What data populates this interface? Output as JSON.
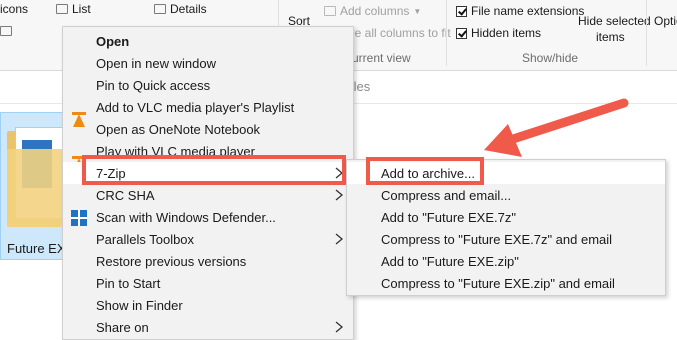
{
  "ribbon": {
    "layout_items": [
      {
        "label": "icons",
        "icon": "large-icons-icon"
      },
      {
        "label": "List",
        "icon": "list-icon"
      },
      {
        "label": "Details",
        "icon": "details-icon"
      }
    ],
    "sort_label": "Sort",
    "add_columns_label": "Add columns",
    "size_columns_label": "ize all columns to fit",
    "current_view_label": "urrent view",
    "file_name_extensions_label": "File name extensions",
    "hidden_items_label": "Hidden items",
    "hide_selected_line1": "Hide selected",
    "hide_selected_line2": "items",
    "show_hide_label": "Show/hide",
    "options_label": "Optic"
  },
  "address_bar": {
    "search_text": "n Files"
  },
  "file": {
    "label": "Future EXE"
  },
  "context_menu": {
    "items": [
      {
        "label": "Open",
        "bold": true,
        "icon": ""
      },
      {
        "label": "Open in new window",
        "icon": ""
      },
      {
        "label": "Pin to Quick access",
        "icon": ""
      },
      {
        "label": "Add to VLC media player's Playlist",
        "icon": "vlc-icon"
      },
      {
        "label": "Open as OneNote Notebook",
        "icon": ""
      },
      {
        "label": "Play with VLC media player",
        "icon": "vlc-icon"
      },
      {
        "label": "7-Zip",
        "icon": "",
        "submenu": true,
        "highlighted": true
      },
      {
        "label": "CRC SHA",
        "icon": "",
        "submenu": true
      },
      {
        "label": "Scan with Windows Defender...",
        "icon": "windows-defender-icon"
      },
      {
        "label": "Parallels Toolbox",
        "icon": "",
        "submenu": true
      },
      {
        "label": "Restore previous versions",
        "icon": ""
      },
      {
        "label": "Pin to Start",
        "icon": ""
      },
      {
        "label": "Show in Finder",
        "icon": ""
      },
      {
        "label": "Share on",
        "icon": "",
        "submenu": true
      }
    ]
  },
  "submenu": {
    "items": [
      {
        "label": "Add to archive...",
        "highlighted": true
      },
      {
        "label": "Compress and email..."
      },
      {
        "label": "Add to \"Future EXE.7z\""
      },
      {
        "label": "Compress to \"Future EXE.7z\" and email"
      },
      {
        "label": "Add to \"Future EXE.zip\""
      },
      {
        "label": "Compress to \"Future EXE.zip\" and email"
      }
    ]
  },
  "colors": {
    "highlight_box": "#ef5a4a",
    "arrow": "#ef5a4a",
    "menu_background": "#f2f2f2",
    "selected_tile": "#cde8fb",
    "vlc_orange": "#f08a16",
    "defender_blue": "#1f72c4"
  }
}
